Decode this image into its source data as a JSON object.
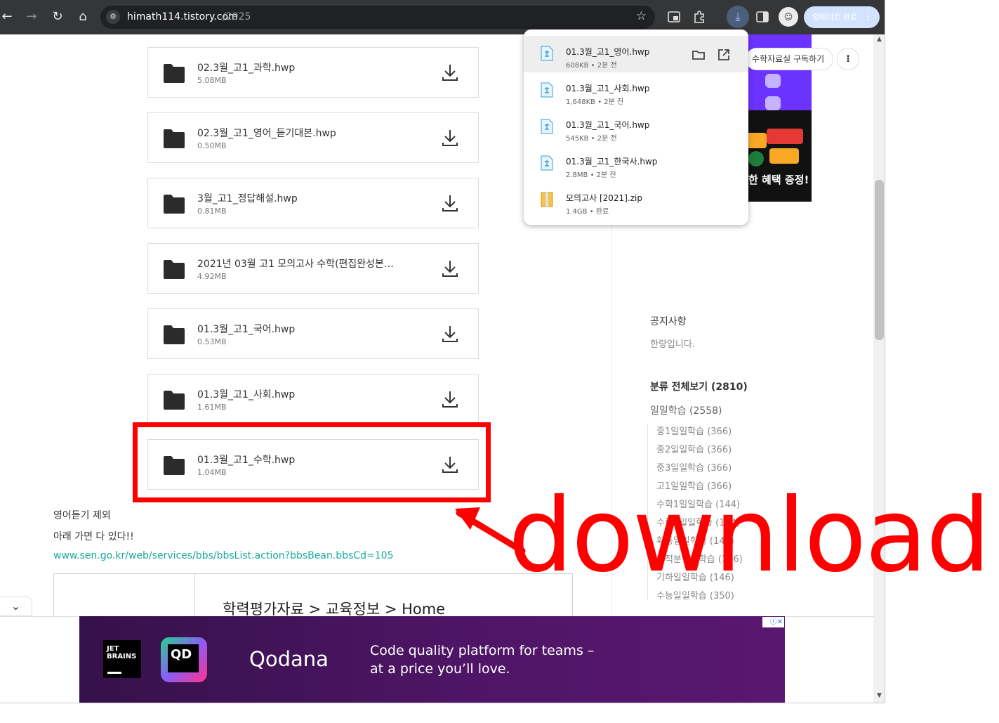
{
  "toolbar": {
    "back_glyph": "←",
    "forward_glyph": "→",
    "reload_glyph": "↻",
    "home_glyph": "⌂",
    "url_host": "himath114.tistory.com",
    "url_path": "/2925",
    "star_glyph": "☆",
    "download_glyph": "⤓",
    "update_label": "업데이트 완료",
    "menu_glyph": "⋮"
  },
  "files": [
    {
      "name": "02.3월_고1_과학.hwp",
      "size": "5.08MB"
    },
    {
      "name": "02.3월_고1_영어_듣기대본.hwp",
      "size": "0.50MB"
    },
    {
      "name": "3월_고1_정답해설.hwp",
      "size": "0.81MB"
    },
    {
      "name": "2021년 03월 고1 모의고사 수학(편집완성본…",
      "size": "4.92MB"
    },
    {
      "name": "01.3월_고1_국어.hwp",
      "size": "0.53MB"
    },
    {
      "name": "01.3월_고1_사회.hwp",
      "size": "1.61MB"
    },
    {
      "name": "01.3월_고1_수학.hwp",
      "size": "1.04MB"
    }
  ],
  "body": {
    "line1": "영어듣기 제외",
    "line2": "아래 가면 다 있다!!",
    "link": "www.sen.go.kr/web/services/bbs/bbsList.action?bbsBean.bbsCd=105",
    "embed_breadcrumb": "학력평가자료 > 교육정보 > Home"
  },
  "sidebar": {
    "subscribe_label": "수학자료실 구독하기",
    "ad_text": "한 혜택 증정!",
    "notice_title": "공지사항",
    "notice_item": "한량입니다.",
    "category_title": "분류 전체보기 (2810)",
    "category_main": "일일학습 (2558)",
    "categories": [
      "중1일일학습 (366)",
      "중2일일학습 (366)",
      "중3일일학습 (366)",
      "고1일일학습 (366)",
      "수학1일일학습 (144)",
      "수학2일일학습 (144)",
      "확통일일학습 (144)",
      "미적분일일학습 (166)",
      "기하일일학습 (146)",
      "수능일일학습 (350)"
    ]
  },
  "downloads": [
    {
      "name": "01.3월_고1_영어.hwp",
      "meta": "608KB • 2분 전",
      "type": "hwp"
    },
    {
      "name": "01.3월_고1_사회.hwp",
      "meta": "1,648KB • 2분 전",
      "type": "hwp"
    },
    {
      "name": "01.3월_고1_국어.hwp",
      "meta": "545KB • 2분 전",
      "type": "hwp"
    },
    {
      "name": "01.3월_고1_한국사.hwp",
      "meta": "2.8MB • 2분 전",
      "type": "hwp"
    },
    {
      "name": "모의고사 [2021].zip",
      "meta": "1.4GB • 완료",
      "type": "zip"
    }
  ],
  "ad": {
    "brand_line1": "JET",
    "brand_line2": "BRAINS",
    "logo_text": "QD",
    "product": "Qodana",
    "tagline1": "Code quality platform for teams –",
    "tagline2": "at a price you’ll love.",
    "choice": "ⓘ✕"
  },
  "annotation": {
    "text": "download",
    "color": "#ff0000"
  },
  "colors": {
    "toolbar_bg": "#353638",
    "link": "#1aa9a0",
    "highlight": "#ff0000"
  }
}
